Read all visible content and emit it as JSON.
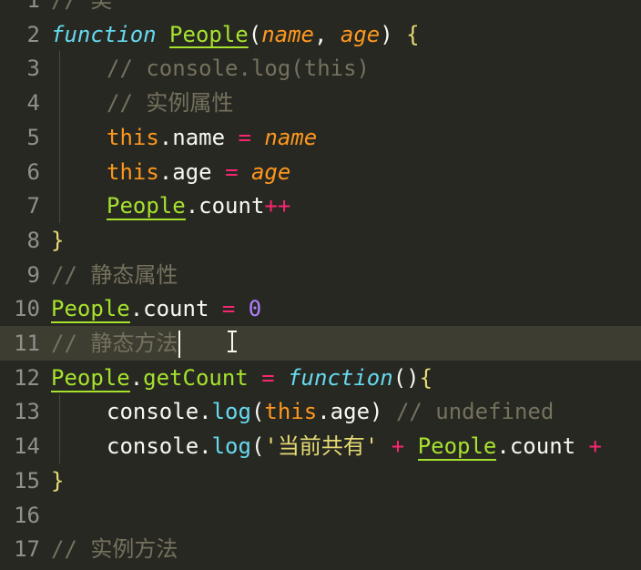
{
  "editor": {
    "lines": [
      {
        "num": "1",
        "parts": [
          [
            "comment",
            "// 类"
          ]
        ]
      },
      {
        "num": "2",
        "parts": [
          [
            "kw-fn",
            "function"
          ],
          [
            "punct",
            " "
          ],
          [
            "fn-name",
            "People"
          ],
          [
            "paren",
            "("
          ],
          [
            "param",
            "name"
          ],
          [
            "punct",
            ", "
          ],
          [
            "param",
            "age"
          ],
          [
            "paren",
            ")"
          ],
          [
            "punct",
            " "
          ],
          [
            "brace",
            "{"
          ]
        ]
      },
      {
        "num": "3",
        "indent": true,
        "parts": [
          [
            "comment",
            "// console.log(this)"
          ]
        ]
      },
      {
        "num": "4",
        "indent": true,
        "parts": [
          [
            "comment",
            "// 实例属性"
          ]
        ]
      },
      {
        "num": "5",
        "indent": true,
        "parts": [
          [
            "this",
            "this"
          ],
          [
            "punct",
            "."
          ],
          [
            "prop",
            "name"
          ],
          [
            "punct",
            " "
          ],
          [
            "op",
            "="
          ],
          [
            "punct",
            " "
          ],
          [
            "param",
            "name"
          ]
        ]
      },
      {
        "num": "6",
        "indent": true,
        "parts": [
          [
            "this",
            "this"
          ],
          [
            "punct",
            "."
          ],
          [
            "prop",
            "age"
          ],
          [
            "punct",
            " "
          ],
          [
            "op",
            "="
          ],
          [
            "punct",
            " "
          ],
          [
            "param",
            "age"
          ]
        ]
      },
      {
        "num": "7",
        "indent": true,
        "parts": [
          [
            "ident-under",
            "People"
          ],
          [
            "punct",
            "."
          ],
          [
            "prop",
            "count"
          ],
          [
            "op",
            "++"
          ]
        ]
      },
      {
        "num": "8",
        "parts": [
          [
            "brace",
            "}"
          ]
        ]
      },
      {
        "num": "9",
        "parts": [
          [
            "comment",
            "// 静态属性"
          ]
        ]
      },
      {
        "num": "10",
        "parts": [
          [
            "ident-under",
            "People"
          ],
          [
            "punct",
            "."
          ],
          [
            "prop",
            "count"
          ],
          [
            "punct",
            " "
          ],
          [
            "op",
            "="
          ],
          [
            "punct",
            " "
          ],
          [
            "num",
            "0"
          ]
        ]
      },
      {
        "num": "11",
        "current": true,
        "cursor": true,
        "parts": [
          [
            "comment",
            "// 静态方法"
          ]
        ]
      },
      {
        "num": "12",
        "parts": [
          [
            "ident-under",
            "People"
          ],
          [
            "punct",
            "."
          ],
          [
            "fn-name-plain",
            "getCount"
          ],
          [
            "punct",
            " "
          ],
          [
            "op",
            "="
          ],
          [
            "punct",
            " "
          ],
          [
            "kw-fn",
            "function"
          ],
          [
            "paren",
            "()"
          ],
          [
            "brace",
            "{"
          ]
        ]
      },
      {
        "num": "13",
        "indent": true,
        "parts": [
          [
            "prop",
            "console"
          ],
          [
            "punct",
            "."
          ],
          [
            "func-call",
            "log"
          ],
          [
            "paren",
            "("
          ],
          [
            "this",
            "this"
          ],
          [
            "punct",
            "."
          ],
          [
            "prop",
            "age"
          ],
          [
            "paren",
            ")"
          ],
          [
            "punct",
            " "
          ],
          [
            "comment",
            "// undefined"
          ]
        ]
      },
      {
        "num": "14",
        "indent": true,
        "parts": [
          [
            "prop",
            "console"
          ],
          [
            "punct",
            "."
          ],
          [
            "func-call",
            "log"
          ],
          [
            "paren",
            "("
          ],
          [
            "str",
            "'当前共有'"
          ],
          [
            "punct",
            " "
          ],
          [
            "op",
            "+"
          ],
          [
            "punct",
            " "
          ],
          [
            "ident-under",
            "People"
          ],
          [
            "punct",
            "."
          ],
          [
            "prop",
            "count"
          ],
          [
            "punct",
            " "
          ],
          [
            "op",
            "+"
          ]
        ]
      },
      {
        "num": "15",
        "parts": [
          [
            "brace",
            "}"
          ]
        ]
      },
      {
        "num": "16",
        "parts": []
      },
      {
        "num": "17",
        "parts": [
          [
            "comment",
            "// 实例方法"
          ]
        ]
      }
    ]
  },
  "colors": {
    "background": "#272822",
    "current_line": "#3e3d32",
    "gutter": "#8f908a",
    "keyword": "#66d9ef",
    "function_name": "#a6e22e",
    "parameter": "#fd971f",
    "operator": "#f92672",
    "number": "#ae81ff",
    "string": "#e6db74",
    "comment": "#75715e"
  },
  "icons": {
    "mouse_cursor": "i-beam-cursor-icon"
  }
}
